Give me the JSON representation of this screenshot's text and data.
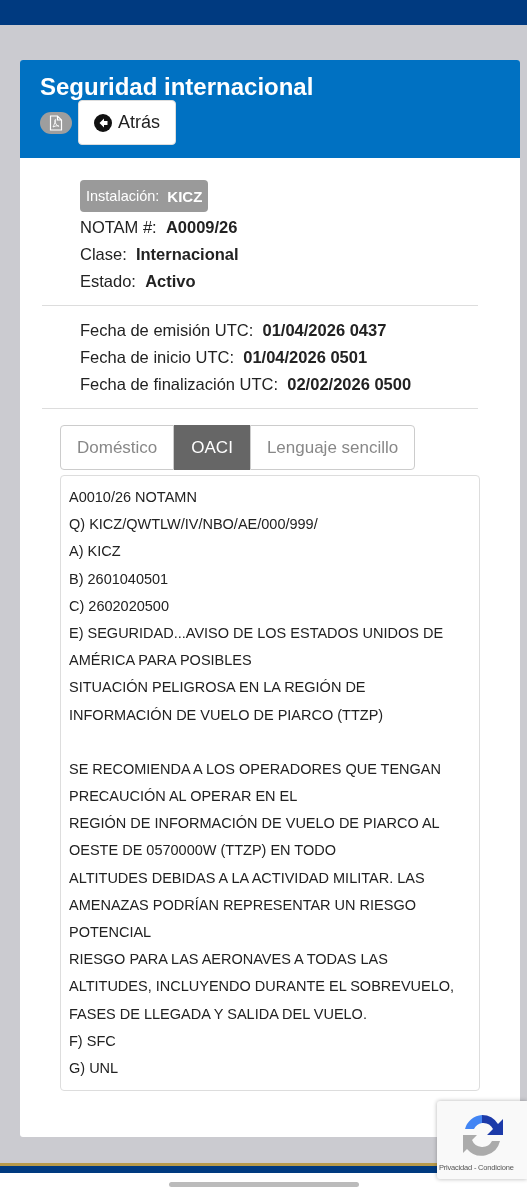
{
  "card": {
    "title": "Seguridad internacional",
    "back_button": "Atrás"
  },
  "facility_badge": {
    "label": "Instalación:",
    "value": "KICZ"
  },
  "fields": [
    {
      "label": "NOTAM #:",
      "value": "A0009/26"
    },
    {
      "label": "Clase:",
      "value": "Internacional"
    },
    {
      "label": "Estado:",
      "value": "Activo"
    }
  ],
  "dates": [
    {
      "label": "Fecha de emisión UTC:",
      "value": "01/04/2026 0437"
    },
    {
      "label": "Fecha de inicio UTC:",
      "value": "01/04/2026 0501"
    },
    {
      "label": "Fecha de finalización UTC:",
      "value": "02/02/2026 0500"
    }
  ],
  "tabs": [
    {
      "label": "Doméstico",
      "selected": false
    },
    {
      "label": "OACI",
      "selected": true
    },
    {
      "label": "Lenguaje sencillo",
      "selected": false
    }
  ],
  "notam_paragraphs": [
    [
      "A0010/26 NOTAMN",
      "Q) KICZ/QWTLW/IV/NBO/AE/000/999/",
      "A) KICZ",
      "B) 2601040501",
      "C) 2602020500",
      "E) SEGURIDAD...AVISO DE LOS ESTADOS UNIDOS DE",
      "AMÉRICA PARA POSIBLES",
      "SITUACIÓN PELIGROSA EN LA REGIÓN DE",
      "INFORMACIÓN DE VUELO DE PIARCO (TTZP)"
    ],
    [
      "SE RECOMIENDA A LOS OPERADORES QUE TENGAN",
      "PRECAUCIÓN AL OPERAR EN EL",
      "REGIÓN DE INFORMACIÓN DE VUELO DE PIARCO AL",
      "OESTE DE 0570000W (TTZP) EN TODO",
      "ALTITUDES DEBIDAS A LA ACTIVIDAD MILITAR. LAS",
      "AMENAZAS PODRÍAN REPRESENTAR UN RIESGO",
      "POTENCIAL",
      "RIESGO PARA LAS AERONAVES A TODAS LAS",
      "ALTITUDES, INCLUYENDO DURANTE EL SOBREVUELO,",
      "FASES DE LLEGADA Y SALIDA DEL VUELO.",
      "F) SFC",
      "G) UNL"
    ]
  ],
  "captcha_badge": {
    "links": "Privacidad - Condicione"
  }
}
